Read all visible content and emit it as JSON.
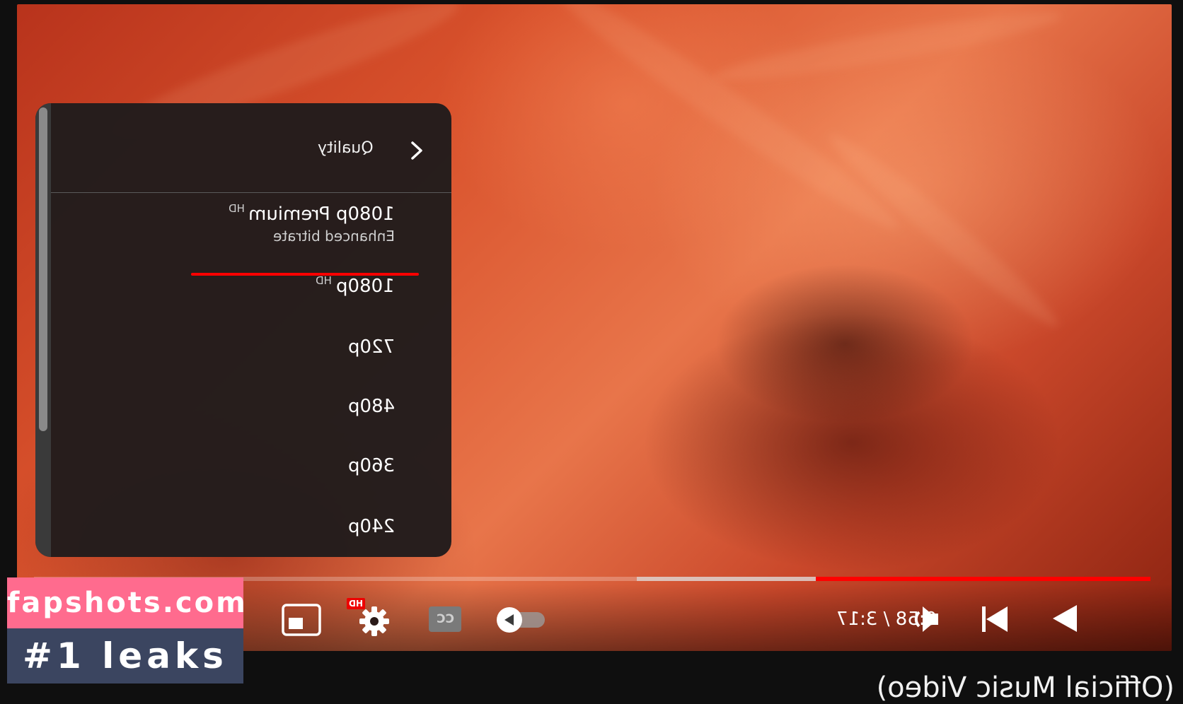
{
  "menu": {
    "title": "Quality",
    "items": [
      {
        "label": "1080p Premium",
        "badge": "HD",
        "sublabel": "Enhanced bitrate",
        "selected": true
      },
      {
        "label": "1080p",
        "badge": "HD"
      },
      {
        "label": "720p"
      },
      {
        "label": "480p"
      },
      {
        "label": "360p"
      },
      {
        "label": "240p"
      }
    ]
  },
  "controls": {
    "time_text": "0:58 / 3:17",
    "settings_badge": "HD",
    "cc_label": "CC",
    "autoplay_on": false,
    "icons": [
      "play-icon",
      "next-icon",
      "volume-icon",
      "autoplay-toggle",
      "cc-icon",
      "settings-gear-icon",
      "miniplayer-icon"
    ]
  },
  "progress": {
    "played_fraction": 0.3,
    "buffered_fraction": 0.46
  },
  "watermark": {
    "line1": "fapshots.com",
    "line2": "#1 leaks"
  },
  "below_video_title": "(Official Music Video)"
}
